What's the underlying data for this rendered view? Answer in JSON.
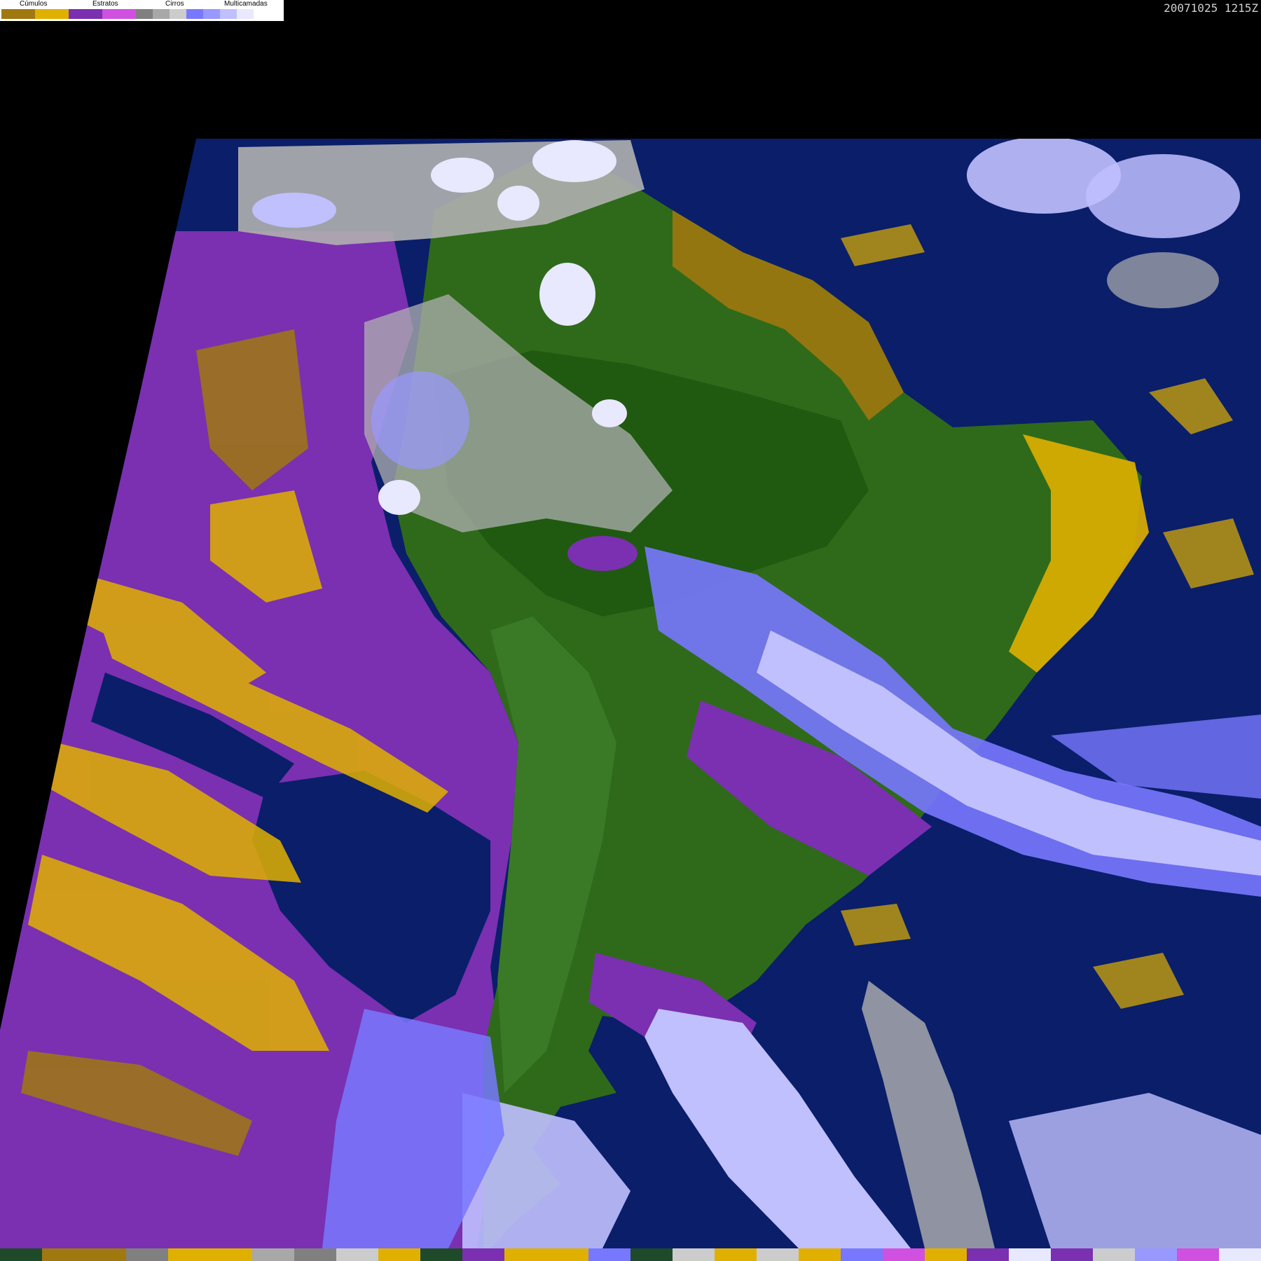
{
  "legend": {
    "categories": [
      {
        "label": "Cúmulos",
        "colors": [
          "#a07810",
          "#e0b000"
        ]
      },
      {
        "label": "Estratos",
        "colors": [
          "#7a30b0",
          "#d050e0"
        ]
      },
      {
        "label": "Cirros",
        "colors": [
          "#808080",
          "#a8a8a8",
          "#cccccc"
        ]
      },
      {
        "label": "Multicamadas",
        "colors": [
          "#7878ff",
          "#9898ff",
          "#c0c0ff",
          "#e8e8ff"
        ]
      }
    ]
  },
  "timestamp": "20071025 1215Z",
  "colors": {
    "background": "#000000",
    "ocean": "#0a1e6a",
    "land": "#2f6a1a",
    "land_dark": "#1f5a10",
    "cumulus_dark": "#a07810",
    "cumulus_light": "#e0b000",
    "stratus": "#7a30b0",
    "stratus_light": "#d050e0",
    "cirrus": "#b0b0b0",
    "multilayer": "#7878ff",
    "multilayer_light": "#c0c0ff"
  },
  "bottom_strip": {
    "colors": [
      "#1e4a2a",
      "#a07810",
      "#a07810",
      "#808080",
      "#e0b000",
      "#e0b000",
      "#a8a8a8",
      "#808080",
      "#cccccc",
      "#e0b000",
      "#1e4a2a",
      "#7a30b0",
      "#e0b000",
      "#e0b000",
      "#7878ff",
      "#1e4a2a",
      "#cccccc",
      "#e0b000",
      "#cccccc",
      "#e0b000",
      "#7878ff",
      "#d050e0",
      "#e0b000",
      "#7a30b0",
      "#e8e8ff",
      "#7a30b0",
      "#cccccc",
      "#9898ff",
      "#d050e0",
      "#e8e8ff"
    ]
  }
}
